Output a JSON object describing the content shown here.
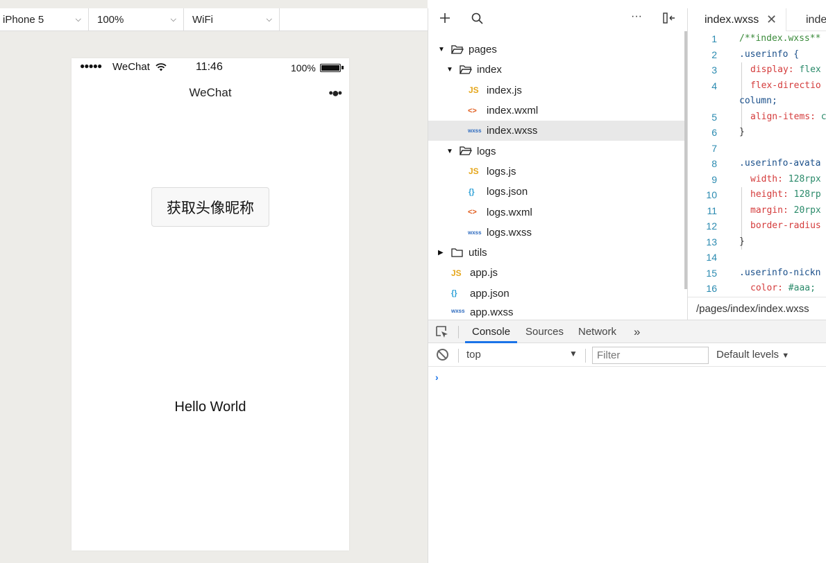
{
  "simulator": {
    "device": "iPhone 5",
    "zoom": "100%",
    "network": "WiFi",
    "status_bar": {
      "signal": "●●●●●",
      "carrier": "WeChat",
      "time": "11:46",
      "battery": "100%"
    },
    "nav_title": "WeChat",
    "nav_more": "•●•",
    "button_label": "获取头像昵称",
    "hello_text": "Hello World"
  },
  "file_tree": {
    "items": [
      {
        "name": "pages",
        "type": "folder",
        "open": true
      },
      {
        "name": "index",
        "type": "folder",
        "open": true
      },
      {
        "name": "index.js",
        "type": "js",
        "badge": "JS"
      },
      {
        "name": "index.wxml",
        "type": "wxml",
        "badge": "<>"
      },
      {
        "name": "index.wxss",
        "type": "wxss",
        "badge": "wxss",
        "selected": true
      },
      {
        "name": "logs",
        "type": "folder",
        "open": true
      },
      {
        "name": "logs.js",
        "type": "js",
        "badge": "JS"
      },
      {
        "name": "logs.json",
        "type": "json",
        "badge": "{}"
      },
      {
        "name": "logs.wxml",
        "type": "wxml",
        "badge": "<>"
      },
      {
        "name": "logs.wxss",
        "type": "wxss",
        "badge": "wxss"
      },
      {
        "name": "utils",
        "type": "folder",
        "open": false
      },
      {
        "name": "app.js",
        "type": "js",
        "badge": "JS"
      },
      {
        "name": "app.json",
        "type": "json",
        "badge": "{}"
      },
      {
        "name": "app.wxss",
        "type": "wxss",
        "badge": "wxss"
      }
    ]
  },
  "editor": {
    "active_tab": "index.wxss",
    "second_tab": "inde",
    "footer_path": "/pages/index/index.wxss",
    "line_numbers": [
      "1",
      "2",
      "3",
      "4",
      "5",
      "6",
      "7",
      "8",
      "9",
      "10",
      "11",
      "12",
      "13",
      "14",
      "15",
      "16"
    ],
    "lines": {
      "l1": "/**index.wxss**",
      "l2": ".userinfo {",
      "l3_prop": "display: ",
      "l3_val": "flex",
      "l4_prop": "flex-directio",
      "l4b": "column;",
      "l5_prop": "align-items: ",
      "l5_val": "c",
      "l6": "}",
      "l8": ".userinfo-avata",
      "l9_prop": "width: ",
      "l9_val": "128rpx",
      "l10_prop": "height: ",
      "l10_val": "128rp",
      "l11_prop": "margin: ",
      "l11_val": "20rpx",
      "l12_prop": "border-radius",
      "l13": "}",
      "l15": ".userinfo-nickn",
      "l16_prop": "color: ",
      "l16_val": "#aaa;"
    }
  },
  "console": {
    "tabs": [
      "Console",
      "Sources",
      "Network"
    ],
    "more": "»",
    "context": "top",
    "filter_placeholder": "Filter",
    "levels": "Default levels",
    "prompt": "›"
  }
}
